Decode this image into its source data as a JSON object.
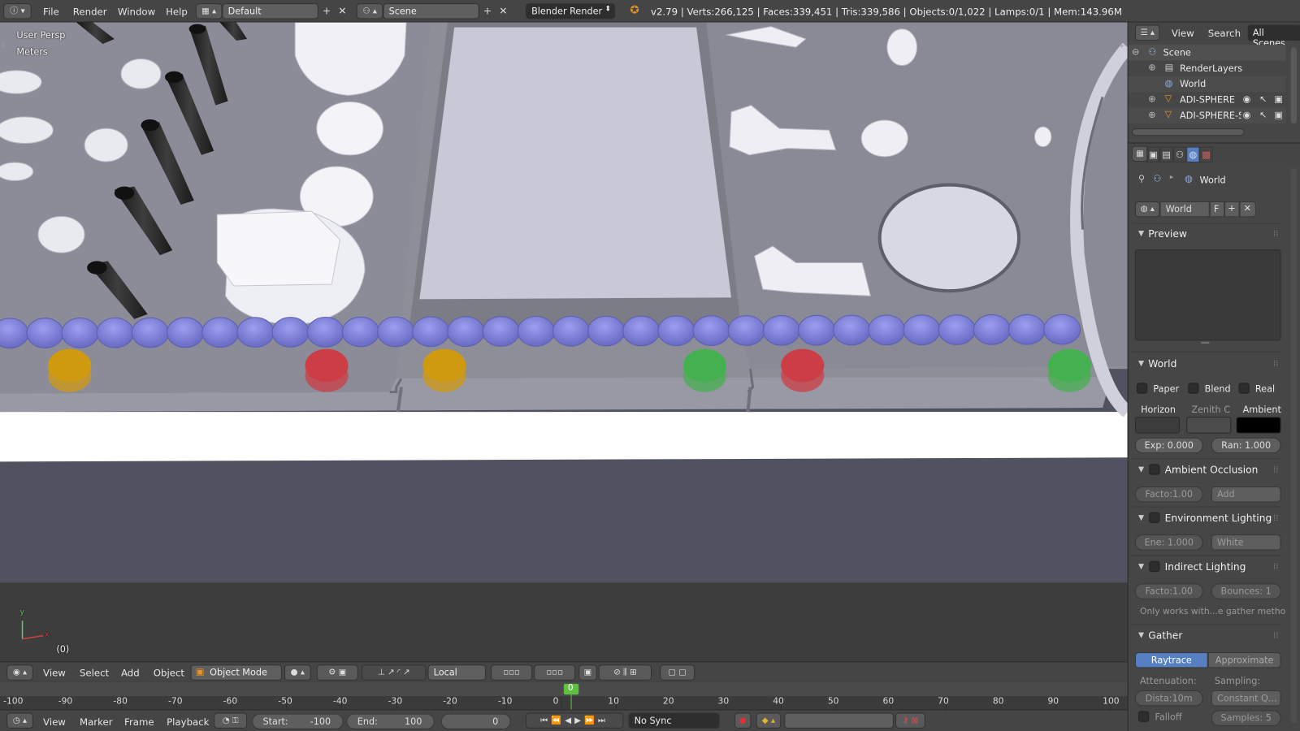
{
  "topbar": {
    "menus": [
      "File",
      "Render",
      "Window",
      "Help"
    ],
    "layout_name": "Default",
    "scene_name": "Scene",
    "render_engine": "Blender Render",
    "stats": "v2.79 | Verts:266,125 | Faces:339,451 | Tris:339,586 | Objects:0/1,022 | Lamps:0/1 | Mem:143.96M"
  },
  "viewport": {
    "view_label": "User Persp",
    "units_label": "Meters",
    "frame_label": "(0)",
    "axis_x": "x",
    "axis_y": "y",
    "buttons": [
      {
        "color": "#d09a10",
        "name": "yellow"
      },
      {
        "color": "#cc3d46",
        "name": "red"
      },
      {
        "color": "#d09a10",
        "name": "yellow"
      },
      {
        "color": "#45b050",
        "name": "green"
      },
      {
        "color": "#cc3d46",
        "name": "red"
      },
      {
        "color": "#45b050",
        "name": "green"
      }
    ],
    "led_color": "#7d7fd6",
    "panel_color": "#8e8e99",
    "floor_color": "#50525f"
  },
  "view3d_header": {
    "menus": [
      "View",
      "Select",
      "Add",
      "Object"
    ],
    "mode": "Object Mode",
    "orientation": "Local"
  },
  "timeline": {
    "ticks": [
      "-100",
      "-90",
      "-80",
      "-70",
      "-60",
      "-50",
      "-40",
      "-30",
      "-20",
      "-10",
      "0",
      "10",
      "20",
      "30",
      "40",
      "50",
      "60",
      "70",
      "80",
      "90",
      "100"
    ],
    "current_frame_marker": "0",
    "menus": [
      "View",
      "Marker",
      "Frame",
      "Playback"
    ],
    "start_label": "Start:",
    "start_value": "-100",
    "end_label": "End:",
    "end_value": "100",
    "current_frame": "0",
    "sync": "No Sync"
  },
  "outliner": {
    "menus": [
      "View",
      "Search"
    ],
    "filter": "All Scenes",
    "items": [
      {
        "label": "Scene",
        "icon": "scene-icon"
      },
      {
        "label": "RenderLayers",
        "icon": "render-layers-icon"
      },
      {
        "label": "World",
        "icon": "world-icon"
      },
      {
        "label": "ADI-SPHERE",
        "icon": "mesh-icon"
      },
      {
        "label": "ADI-SPHERE-SI",
        "icon": "mesh-icon"
      }
    ]
  },
  "properties": {
    "breadcrumb": "World",
    "world_name": "World",
    "fake_user": "F",
    "sections": {
      "preview": "Preview",
      "world": "World",
      "ao": "Ambient Occlusion",
      "env": "Environment Lighting",
      "indirect": "Indirect Lighting",
      "gather": "Gather"
    },
    "world_checks": [
      "Paper",
      "Blend",
      "Real"
    ],
    "colors": {
      "horizon_label": "Horizon",
      "zenith_label": "Zenith C",
      "ambient_label": "Ambient",
      "horizon": "#3c3c3c",
      "zenith": "#4c4c4c",
      "ambient": "#000000"
    },
    "exposure": "Exp: 0.000",
    "range": "Ran: 1.000",
    "ao_factor": "Facto:1.00",
    "ao_blend": "Add",
    "env_energy": "Ene: 1.000",
    "env_color": "White",
    "ind_factor": "Facto:1.00",
    "ind_bounces": "Bounces: 1",
    "ind_note": "Only works with...e gather metho",
    "gather_raytrace": "Raytrace",
    "gather_approx": "Approximate",
    "attenuation_label": "Attenuation:",
    "sampling_label": "Sampling:",
    "distance": "Dista:10m",
    "sampling_mode": "Constant Q...",
    "falloff": "Falloff",
    "samples": "Samples: 5"
  }
}
